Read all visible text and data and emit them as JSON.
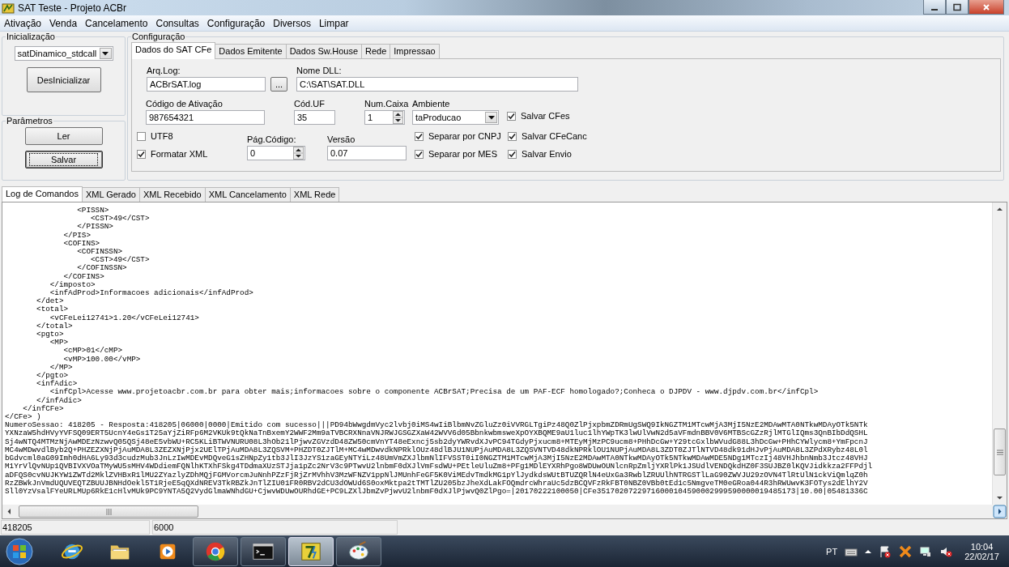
{
  "window": {
    "title": "SAT Teste - Projeto ACBr"
  },
  "menu": [
    "Ativação",
    "Venda",
    "Cancelamento",
    "Consultas",
    "Configuração",
    "Diversos",
    "Limpar"
  ],
  "initialization": {
    "title": "Inicialização",
    "library": "satDinamico_stdcall",
    "button": "DesInicializar"
  },
  "parameters": {
    "title": "Parâmetros",
    "buttons": [
      {
        "label": "Ler",
        "focused": false
      },
      {
        "label": "Salvar",
        "focused": true
      }
    ]
  },
  "configuration": {
    "title": "Configuração",
    "tabs": [
      {
        "label": "Dados do SAT CFe",
        "selected": true
      },
      {
        "label": "Dados Emitente",
        "selected": false
      },
      {
        "label": "Dados Sw.House",
        "selected": false
      },
      {
        "label": "Rede",
        "selected": false
      },
      {
        "label": "Impressao",
        "selected": false
      }
    ],
    "arq_log": {
      "label": "Arq.Log:",
      "value": "ACBrSAT.log"
    },
    "browse_button": "...",
    "nome_dll": {
      "label": "Nome DLL:",
      "value": "C:\\SAT\\SAT.DLL"
    },
    "codigo_ativacao": {
      "label": "Código de Ativação",
      "value": "987654321"
    },
    "cod_uf": {
      "label": "Cód.UF",
      "value": "35"
    },
    "num_caixa": {
      "label": "Num.Caixa",
      "value": "1"
    },
    "ambiente": {
      "label": "Ambiente",
      "value": "taProducao"
    },
    "pag_codigo": {
      "label": "Pág.Código:",
      "value": "0"
    },
    "versao": {
      "label": "Versão",
      "value": "0.07"
    },
    "utf8": {
      "label": "UTF8",
      "checked": false
    },
    "formatar_xml": {
      "label": "Formatar XML",
      "checked": true
    },
    "separar_cnpj": {
      "label": "Separar por CNPJ",
      "checked": true
    },
    "separar_mes": {
      "label": "Separar por MES",
      "checked": true
    },
    "salvar_cfes": {
      "label": "Salvar CFes",
      "checked": true
    },
    "salvar_cfecanc": {
      "label": "Salvar CFeCanc",
      "checked": true
    },
    "salvar_envio": {
      "label": "Salvar Envio",
      "checked": true
    }
  },
  "log": {
    "tabs": [
      {
        "label": "Log de Comandos",
        "selected": true
      },
      {
        "label": "XML Gerado",
        "selected": false
      },
      {
        "label": "XML Recebido",
        "selected": false
      },
      {
        "label": "XML Cancelamento",
        "selected": false
      },
      {
        "label": "XML Rede",
        "selected": false
      }
    ],
    "lines": [
      "                <PISSN>",
      "                   <CST>49</CST>",
      "                </PISSN>",
      "             </PIS>",
      "             <COFINS>",
      "                <COFINSSN>",
      "                   <CST>49</CST>",
      "                </COFINSSN>",
      "             </COFINS>",
      "          </imposto>",
      "          <infAdProd>Informacoes adicionais</infAdProd>",
      "       </det>",
      "       <total>",
      "          <vCFeLei12741>1.20</vCFeLei12741>",
      "       </total>",
      "       <pgto>",
      "          <MP>",
      "             <cMP>01</cMP>",
      "             <vMP>100.00</vMP>",
      "          </MP>",
      "       </pgto>",
      "       <infAdic>",
      "          <infCpl>Acesse www.projetoacbr.com.br para obter mais;informacoes sobre o componente ACBrSAT;Precisa de um PAF-ECF homologado?;Conheca o DJPDV - www.djpdv.com.br</infCpl>",
      "       </infAdic>",
      "    </infCFe>",
      "</CFe> )",
      "NumeroSessao: 418205 - Resposta:418205|06000|0000|Emitido com sucesso|||PD94bWwgdmVyc2lvbj0iMS4wIiBlbmNvZGluZz0iVVRGLTgiPz48Q0ZlPjxpbmZDRmUgSWQ9IkNGZTM1MTcwMjA3MjI5NzE2MDAwMTA0NTkwMDAyOTk5NTk",
      "YXNzaW5hdHVyYVFSQ09ERT5UcnY4eGs1T25aYjZiRFp6M2VKUk9tQkNaTnBxemY2WWF2Mm9aTVBCRXNnaVNJRWJGSGZXaW42WVV6d05BbnkwbmsweXpOYXBQME9aU1luc1lhYWpTK3lwUlVwN2d5aVFmdnBBV0V6MTBScGZzRjlMTGlIQms3QnBIbDdQSHL",
      "Sj4wNTQ4MTMzNjAwMDEzNzwvQ05QSj48eE5vbWU+RC5KLiBTWVNURU08L3hOb21lPjwvZGVzdD48ZW50cmVnYT48eExncj5sb2dyYWRvdXJvPC94TGdyPjxucm8+MTEyMjMzPC9ucm8+PHhDcGw+Y29tcGxlbWVudG88L3hDcGw+PHhCYWlycm8+YmFpcnJ",
      "MC4wMDwvdlByb2Q+PHZEZXNjPjAuMDA8L3ZEZXNjPjx2UElTPjAuMDA8L3ZQSVM+PHZDT0ZJTlM+MC4wMDwvdkNPRklOUz48dlBJU1NUPjAuMDA8L3ZQSVNTVD48dkNPRklOU1NUPjAuMDA8L3ZDT0ZJTlNTVD48dk91dHJvPjAuMDA8L3ZPdXRybz48L0l",
      "bGdvcml0aG09Imh0dHA6Ly93d3cudzMub3JnLzIwMDEvMDQveG1sZHNpZy1tb3JlI3JzYS1zaGEyNTYiLz48UmVmZXJlbmNlIFVSST0iI0NGZTM1MTcwMjA3MjI5NzE2MDAwMTA0NTkwMDAyOTk5NTkwMDAwMDE5NDg1MTczIj48VHJhbnNmb3Jtcz48VHJ",
      "M1YrVlQvNUp1QVBIVXVOaTMyWU5sMHV4WDdiemFQNlhKTXhFSkg4TDdmaXUzSTJja1pZc2NrV3c9PTwvU2lnbmF0dXJlVmFsdWU+PEtleUluZm8+PFg1MDlEYXRhPgo8WDUwOUNlcnRpZmljYXRlPk1JSUdlVENDQkdHZ0F3SUJBZ0lKQVJidkkza2FFPdjl",
      "aDFQS0cvNUJKYW1ZWTd2MklZVHBxR1lMU2ZYazlyZDhMQjFGMVorcmJuNnhPZzFjRjZrMVhhV3MzWFNZV1ppNlJMUnhFeGF5K0ViMEdvTmdkMG1pYlJydkdsWUtBTUZQRlN4eUxGa3RwblZRUUlhNTRGSTlLaG90ZWVJU29zOVN4TlRtUlN1ckViQmlqZ0h",
      "RzZBWkJnVmdUQUVEQTZBUUJBNHdOekl5T1RjeE5qQXdNREV3TkRBZkJnTlZIU01FR0RBV2dCU3dOWUd6S0oxMktpa2tTMTlZU205bzJheXdLakFOQmdrcWhraUc5dzBCQVFzRkFBT0NBZ0VBb0tEd1c5NmgveTM0eGRoa044R3hRWUwvK3FOTys2dElhY2V",
      "Sll0YzVsalFYeURLMUp6RkE1cHlvMUk9PC9YNTA5Q2VydGlmaWNhdGU+CjwvWDUwOURhdGE+PC9LZXlJbmZvPjwvU2lnbmF0dXJlPjwvQ0ZlPgo=|20170222100050|CFe35170207229716000104590002999590000019485173|10.00|05481336C"
    ]
  },
  "status_bar": [
    "418205",
    "6000"
  ],
  "taskbar": {
    "apps": [
      {
        "kind": "browser-e",
        "running": false,
        "active": false
      },
      {
        "kind": "folder",
        "running": false,
        "active": false
      },
      {
        "kind": "media",
        "running": false,
        "active": false
      },
      {
        "kind": "browser-circle",
        "running": true,
        "active": false
      },
      {
        "kind": "terminal",
        "running": true,
        "active": false
      },
      {
        "kind": "app7",
        "running": true,
        "active": true
      },
      {
        "kind": "paint",
        "running": true,
        "active": false
      }
    ],
    "language": "PT",
    "time": "10:04",
    "date": "22/02/17"
  }
}
